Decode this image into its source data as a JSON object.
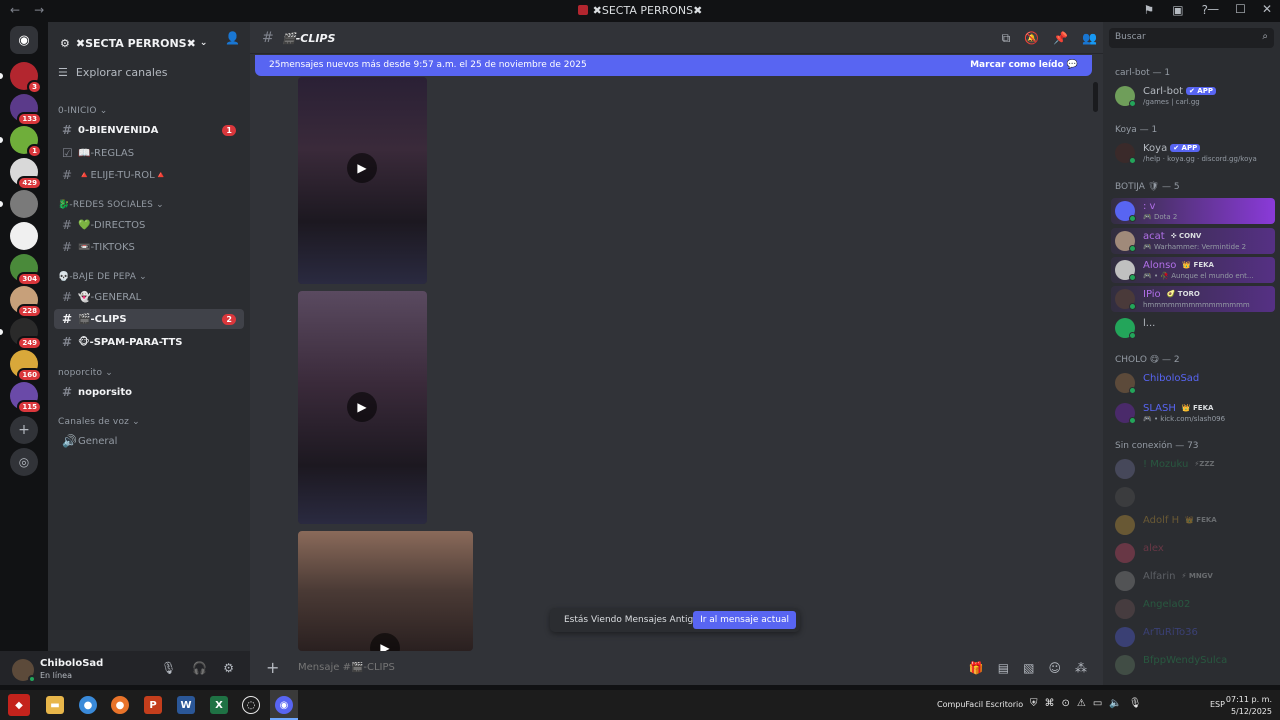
{
  "window": {
    "title": "✖SECTA PERRONS✖",
    "nav_back": "←",
    "nav_forward": "→"
  },
  "guilds": [
    {
      "name": "server-1",
      "badge": "3",
      "color": "#b3262f"
    },
    {
      "name": "server-2",
      "badge": "133",
      "color": "#5b3a8a"
    },
    {
      "name": "server-3",
      "badge": "1",
      "color": "#6fae3a"
    },
    {
      "name": "server-4",
      "badge": "429",
      "color": "#d9d9d9"
    },
    {
      "name": "server-5",
      "badge": "",
      "color": "#7a7a7a"
    },
    {
      "name": "server-6",
      "badge": "",
      "color": "#f0f0f0"
    },
    {
      "name": "server-7",
      "badge": "304",
      "color": "#4a8a3a"
    },
    {
      "name": "server-8",
      "badge": "228",
      "color": "#c7a07a"
    },
    {
      "name": "server-9",
      "badge": "249",
      "color": "#2a2a2a"
    },
    {
      "name": "server-10",
      "badge": "160",
      "color": "#d9a83a"
    },
    {
      "name": "server-11",
      "badge": "115",
      "color": "#6a4aa8"
    }
  ],
  "sidebar": {
    "server_name": "✖SECTA PERRONS✖",
    "explore": "Explorar canales",
    "categories": {
      "inicio": "0-INICIO",
      "redes": "🐉-REDES SOCIALES",
      "baje": "💀-BAJE DE PEPA",
      "noporcito": "noporcito",
      "voz": "Canales de voz"
    },
    "channels": {
      "bienvenida": "0-BIENVENIDA",
      "bienvenida_mention": "1",
      "reglas": "📖-REGLAS",
      "rol": "🔺ELIJE-TU-ROL🔺",
      "directos": "💚-DIRECTOS",
      "tiktoks": "📼-TIKTOKS",
      "general": "👻-GENERAL",
      "clips": "🎬-CLIPS",
      "clips_mention": "2",
      "spam": "🐵-SPAM-PARA-TTS",
      "noporsito": "noporsito",
      "voice_general": "General"
    }
  },
  "user": {
    "name": "ChiboloSad",
    "status": "En línea"
  },
  "chat": {
    "channel_name": "🎬-CLIPS",
    "new_messages": "25mensajes nuevos más desde 9:57 a.m. el 25 de noviembre de 2025",
    "mark_read": "Marcar como leído",
    "old_messages": "Estás Viendo Mensajes Antiguos",
    "jump_present": "Ir al mensaje actual",
    "composer_placeholder": "Mensaje #🎬-CLIPS"
  },
  "members": {
    "search_placeholder": "Buscar",
    "groups": [
      {
        "label": "carl-bot — 1"
      },
      {
        "label": "Koya — 1"
      },
      {
        "label": "BOTIJA 🛡 — 5"
      },
      {
        "label": "CHOLO 😋 — 2"
      },
      {
        "label": "Sin conexión — 73"
      }
    ],
    "list": [
      {
        "name": "Carl-bot",
        "tag": "✔ APP",
        "sub": "/games | carl.gg",
        "color": "#b5bac1",
        "avatar": "#6f9e5a"
      },
      {
        "name": "Koya",
        "tag": "✔ APP",
        "sub": "/help · koya.gg · discord.gg/koya",
        "color": "#b5bac1",
        "avatar": "#3a2a2a"
      },
      {
        "name": ": v",
        "tag": "",
        "sub": "🎮 Dota 2",
        "color": "#b06fe8",
        "avatar": "#5865f2"
      },
      {
        "name": "acat",
        "tag": "✜ CONV",
        "sub": "🎮 Warhammer: Vermintide 2",
        "color": "#b06fe8",
        "avatar": "#a08a7a"
      },
      {
        "name": "Alonso",
        "tag": "👑 FEKA",
        "sub": "🎮 • 🥀 Aunque el mundo ent...",
        "color": "#b06fe8",
        "avatar": "#c0c0c0"
      },
      {
        "name": "IPio",
        "tag": "🥑 TORO",
        "sub": "hmmmmmmmmmmmmmmm",
        "color": "#b06fe8",
        "avatar": "#4a3a3a"
      },
      {
        "name": "l...",
        "tag": "",
        "sub": "",
        "color": "#b5bac1",
        "avatar": "#23a55a"
      },
      {
        "name": "ChiboloSad",
        "tag": "",
        "sub": "",
        "color": "#5865f2",
        "avatar": "#5c4a3a"
      },
      {
        "name": "SLASH",
        "tag": "👑 FEKA",
        "sub": "🎮 • kick.com/slash096",
        "color": "#5865f2",
        "avatar": "#4a2a6a"
      },
      {
        "name": "! Mozuku",
        "tag": "⚡ZZZ",
        "sub": "",
        "color": "#23a55a",
        "avatar": "#7a7aa8"
      },
      {
        "name": "",
        "tag": "",
        "sub": "",
        "color": "#b5bac1",
        "avatar": "#5a5a5a"
      },
      {
        "name": "Adolf H",
        "tag": "👑 FEKA",
        "sub": "",
        "color": "#d9a83a",
        "avatar": "#d9a83a"
      },
      {
        "name": "alex",
        "tag": "",
        "sub": "",
        "color": "#d94a6a",
        "avatar": "#d94a6a"
      },
      {
        "name": "Alfarin",
        "tag": "⚡ MNGV",
        "sub": "",
        "color": "#b5bac1",
        "avatar": "#9a9a9a"
      },
      {
        "name": "Angela02",
        "tag": "",
        "sub": "",
        "color": "#23a55a",
        "avatar": "#7a5a5a"
      },
      {
        "name": "ArTuRiTo36",
        "tag": "",
        "sub": "",
        "color": "#5865f2",
        "avatar": "#5865f2"
      },
      {
        "name": "BfppWendySulca",
        "tag": "",
        "sub": "",
        "color": "#23a55a",
        "avatar": "#6a8a6a"
      }
    ]
  },
  "taskbar": {
    "tray_label": "CompuFacil Escritorio",
    "lang": "ESP",
    "time": "07:11 p. m.",
    "date": "5/12/2025"
  },
  "colors": {
    "accent": "#5865f2",
    "danger": "#da373c",
    "online": "#23a55a"
  }
}
